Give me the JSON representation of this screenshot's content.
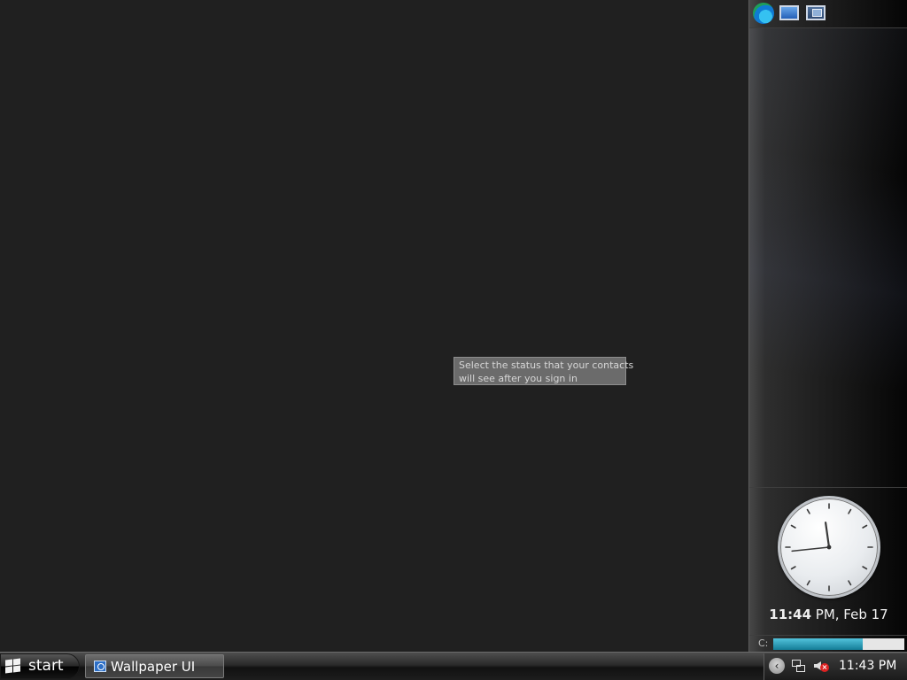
{
  "tooltip": {
    "line1": "Select the status that your contacts",
    "line2": "will see after you sign in"
  },
  "sidebar": {
    "toolbar_icons": [
      "edge-browser-icon",
      "picture-gadget-icon",
      "slideshow-gadget-icon"
    ],
    "clock": {
      "hour": 11,
      "minute": 44
    },
    "time_display": {
      "time": "11:44",
      "suffix": " PM, Feb 17"
    },
    "drive": {
      "label": "C:",
      "used_fraction": 0.68,
      "fill_color": "#2aa3bf"
    }
  },
  "taskbar": {
    "start_label": "start",
    "task_button_label": "Wallpaper UI",
    "tray_time": "11:43 PM",
    "tray_icons": [
      "chevron-left-icon",
      "network-icon",
      "volume-muted-icon"
    ]
  }
}
